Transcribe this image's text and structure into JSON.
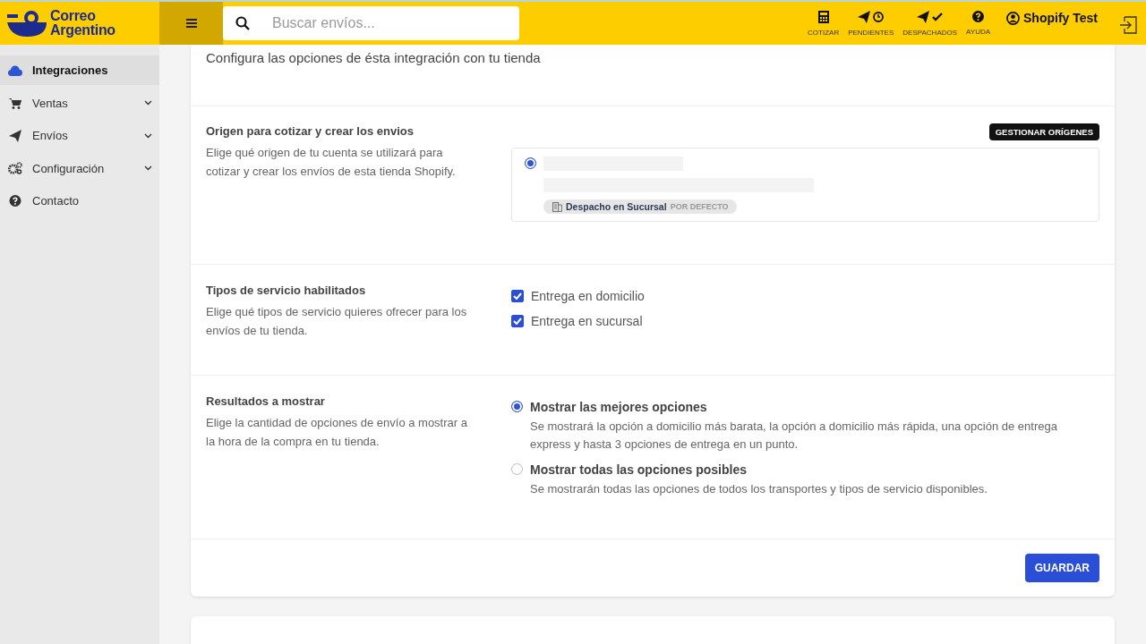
{
  "header": {
    "brand": [
      "Correo",
      "Argentino"
    ],
    "search": {
      "placeholder": "Buscar envíos..."
    },
    "actions": [
      {
        "kind": "calculator",
        "label": "COTIZAR"
      },
      {
        "kind": "pending",
        "label": "PENDIENTES"
      },
      {
        "kind": "dispatched",
        "label": "DESPACHADOS"
      },
      {
        "kind": "help",
        "label": "AYUDA"
      }
    ],
    "user": "Shopify Test"
  },
  "sidebar": {
    "items": [
      {
        "label": "Integraciones",
        "selected": true,
        "expandable": false
      },
      {
        "label": "Ventas",
        "selected": false,
        "expandable": true
      },
      {
        "label": "Envíos",
        "selected": false,
        "expandable": true
      },
      {
        "label": "Configuración",
        "selected": false,
        "expandable": true
      },
      {
        "label": "Contacto",
        "selected": false,
        "expandable": false
      }
    ]
  },
  "intro": "Configura las opciones de ésta integración con tu tienda",
  "origin": {
    "title": "Origen para cotizar y crear los envios",
    "description": "Elige qué origen de tu cuenta se utilizará para cotizar y crear los envíos de esta tienda Shopify.",
    "manage_button": "GESTIONAR ORÍGENES",
    "options": [
      {
        "selected": true,
        "tag": "Despacho en Sucursal",
        "tag_note": "POR DEFECTO"
      }
    ]
  },
  "services": {
    "title": "Tipos de servicio habilitados",
    "description": "Elige qué tipos de servicio quieres ofrecer para los envíos de tu tienda.",
    "options": [
      {
        "label": "Entrega en domicilio",
        "checked": true
      },
      {
        "label": "Entrega en sucursal",
        "checked": true
      }
    ]
  },
  "results": {
    "title": "Resultados a mostrar",
    "description": "Elige la cantidad de opciones de envío a mostrar a la hora de la compra en tu tienda.",
    "options": [
      {
        "label": "Mostrar las mejores opciones",
        "description": "Se mostrará la opción a domicilio más barata, la opción a domicilio más rápida, una opción de entrega express y hasta 3 opciones de entrega en un punto.",
        "selected": true
      },
      {
        "label": "Mostrar todas las opciones posibles",
        "description": "Se mostrarán todas las opciones de todos los transportes y tipos de servicio disponibles.",
        "selected": false
      }
    ]
  },
  "save_button": "GUARDAR"
}
